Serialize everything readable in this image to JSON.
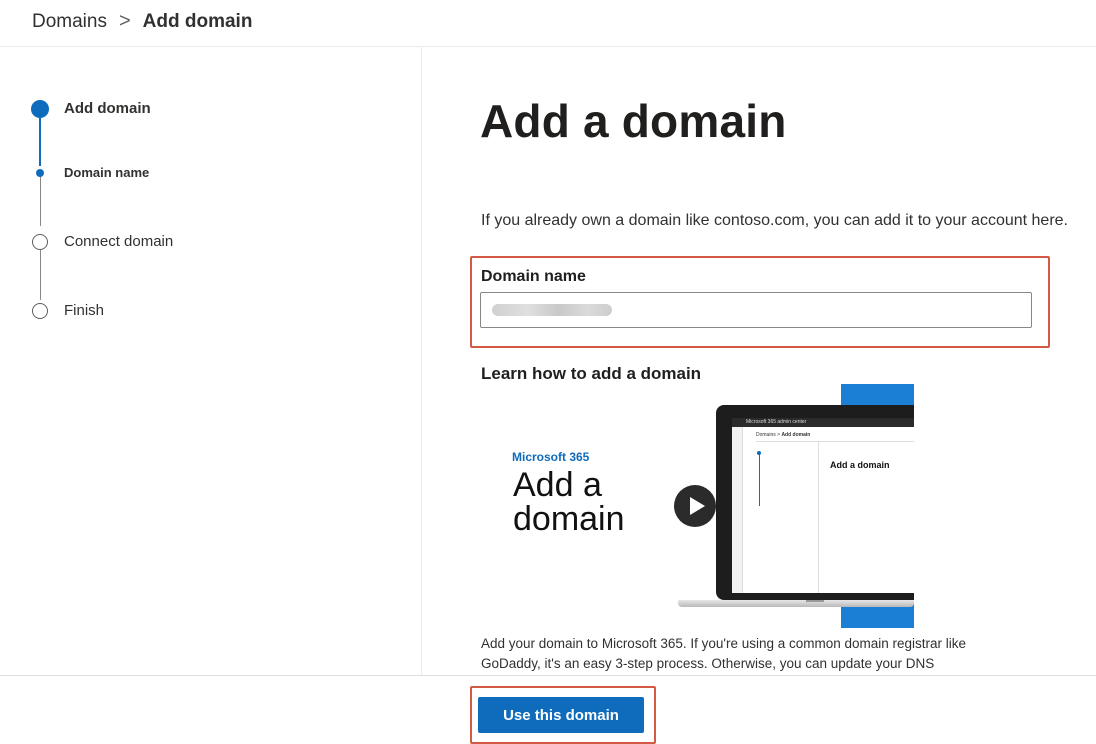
{
  "breadcrumb": {
    "root": "Domains",
    "separator": ">",
    "current": "Add domain"
  },
  "stepper": {
    "steps": [
      {
        "label": "Add domain"
      },
      {
        "label": "Domain name"
      },
      {
        "label": "Connect domain"
      },
      {
        "label": "Finish"
      }
    ]
  },
  "main": {
    "title": "Add a domain",
    "intro": "If you already own a domain like contoso.com, you can add it to your account here.",
    "domain_field": {
      "label": "Domain name"
    },
    "learn": {
      "heading": "Learn how to add a domain",
      "video": {
        "brand": "Microsoft 365",
        "headline": "Add a domain",
        "screen_app_title": "Microsoft 365 admin center",
        "screen_breadcrumb_root": "Domains",
        "screen_breadcrumb_sep": ">",
        "screen_breadcrumb_current": "Add domain",
        "screen_title": "Add a domain",
        "play_icon": "play-icon"
      }
    },
    "description": "Add your domain to Microsoft 365. If you're using a common domain registrar like GoDaddy, it's an easy 3-step process. Otherwise, you can update your DNS"
  },
  "footer": {
    "primary_button": "Use this domain"
  },
  "colors": {
    "accent": "#0f6cbd",
    "highlight": "#d35b45"
  }
}
